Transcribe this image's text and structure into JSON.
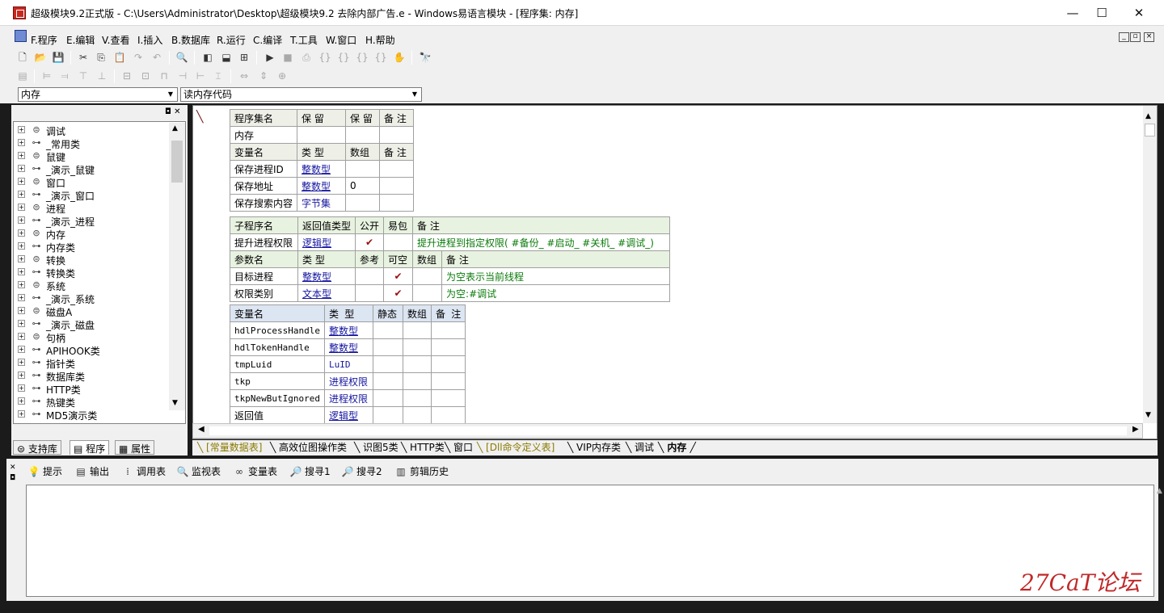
{
  "window": {
    "title": "超级模块9.2正式版 - C:\\Users\\Administrator\\Desktop\\超级模块9.2 去除内部广告.e - Windows易语言模块 - [程序集: 内存]",
    "minimize": "—",
    "maximize": "☐",
    "close": "✕"
  },
  "menu": [
    "F.程序",
    "E.编辑",
    "V.查看",
    "I.插入",
    "B.数据库",
    "R.运行",
    "C.编译",
    "T.工具",
    "W.窗口",
    "H.帮助"
  ],
  "combos": {
    "left": "内存",
    "right": "读内存代码"
  },
  "tree": [
    "调试",
    "_常用类",
    "鼠键",
    "_演示_鼠键",
    "窗口",
    "_演示_窗口",
    "进程",
    "_演示_进程",
    "内存",
    "内存类",
    "转换",
    "转换类",
    "系统",
    "_演示_系统",
    "磁盘A",
    "_演示_磁盘",
    "句柄",
    "APIHOOK类",
    "指针类",
    "数据库类",
    "HTTP类",
    "热键类",
    "MD5演示类"
  ],
  "left_tabs": [
    "支持库",
    "程序",
    "属性"
  ],
  "assembly_table": {
    "headers": [
      "程序集名",
      "保 留",
      "保 留",
      "备 注"
    ],
    "name": "内存",
    "var_headers": [
      "变量名",
      "类 型",
      "数组",
      "备 注"
    ],
    "vars": [
      {
        "name": "保存进程ID",
        "type": "整数型",
        "array": ""
      },
      {
        "name": "保存地址",
        "type": "整数型",
        "array": "0"
      },
      {
        "name": "保存搜索内容",
        "type": "字节集",
        "array": ""
      }
    ]
  },
  "sub_table": {
    "headers": [
      "子程序名",
      "返回值类型",
      "公开",
      "易包",
      "备 注"
    ],
    "name": "提升进程权限",
    "ret": "逻辑型",
    "public": "✔",
    "remark": "提升进程到指定权限( #备份_ #启动_ #关机_ #调试_)",
    "param_headers": [
      "参数名",
      "类 型",
      "参考",
      "可空",
      "数组",
      "备 注"
    ],
    "params": [
      {
        "name": "目标进程",
        "type": "整数型",
        "nullable": "✔",
        "remark": "为空表示当前线程"
      },
      {
        "name": "权限类别",
        "type": "文本型",
        "nullable": "✔",
        "remark": "为空:#调试"
      }
    ]
  },
  "local_table": {
    "headers": [
      "变量名",
      "类 型",
      "静态",
      "数组",
      "备 注"
    ],
    "vars": [
      {
        "name": "hdlProcessHandle",
        "type": "整数型"
      },
      {
        "name": "hdlTokenHandle",
        "type": "整数型"
      },
      {
        "name": "tmpLuid",
        "type": "LuID"
      },
      {
        "name": "tkp",
        "type": "进程权限"
      },
      {
        "name": "tkpNewButIgnored",
        "type": "进程权限"
      },
      {
        "name": "返回值",
        "type": "逻辑型"
      }
    ]
  },
  "doc_tabs": [
    "[常量数据表]",
    "高效位图操作类",
    "识图5类",
    "HTTP类",
    "窗口",
    "[Dll命令定义表]",
    "VIP内存类",
    "调试",
    "内存"
  ],
  "bottom_tabs": [
    "提示",
    "输出",
    "调用表",
    "监视表",
    "变量表",
    "搜寻1",
    "搜寻2",
    "剪辑历史"
  ],
  "watermark": "27CaT论坛"
}
